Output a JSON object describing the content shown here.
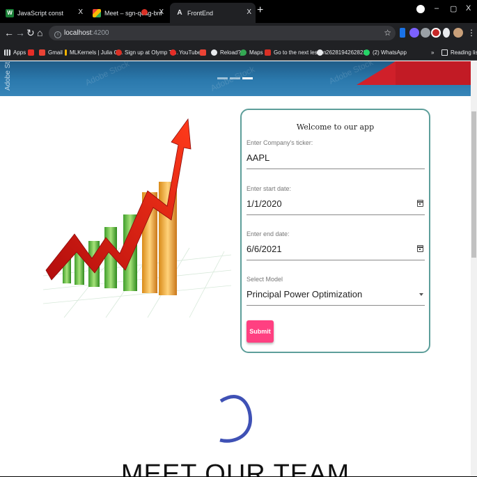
{
  "browser": {
    "tabs": [
      {
        "title": "JavaScript const",
        "active": false
      },
      {
        "title": "Meet – sgn-qoag-bnr",
        "active": false
      },
      {
        "title": "FrontEnd",
        "active": true
      }
    ],
    "url_host": "localhost",
    "url_port": ":4200",
    "bookmarks": [
      "Apps",
      "Gmail",
      "MLKernels | Julia O...",
      "Sign up at Olymp Tr...",
      "YouTube",
      "Reload?",
      "Maps",
      "Go to the next lesson",
      "26281942628211",
      "(2) WhatsApp"
    ],
    "reading_list": "Reading list",
    "icons": [
      "back-icon",
      "forward-icon",
      "reload-icon",
      "home-icon",
      "star-icon",
      "close-icon",
      "minimize-icon",
      "maximize-icon"
    ]
  },
  "hero": {
    "side_text": "Adobe St",
    "slide_count": 3,
    "active_slide": 3
  },
  "form": {
    "title": "Welcome to our app",
    "ticker_label": "Enter Company's ticker:",
    "ticker_value": "AAPL",
    "start_label": "Enter start date:",
    "start_value": "1/1/2020",
    "end_label": "Enter end date:",
    "end_value": "6/6/2021",
    "model_label": "Select Model",
    "model_value": "Principal Power Optimization",
    "submit_label": "Submit"
  },
  "section": {
    "team_heading": "MEET OUR TEAM"
  },
  "colors": {
    "accent": "#ff4081",
    "card_border": "#5d9e9a",
    "spinner": "#3f51b5"
  }
}
